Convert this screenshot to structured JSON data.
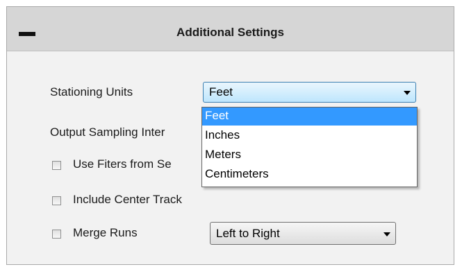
{
  "panel": {
    "title": "Additional Settings",
    "collapse_icon": "minus-icon"
  },
  "stationing": {
    "label": "Stationing Units",
    "selected": "Feet",
    "options": [
      "Feet",
      "Inches",
      "Meters",
      "Centimeters"
    ]
  },
  "output_sampling": {
    "label": "Output Sampling Inter"
  },
  "use_filters": {
    "label": "Use Fiters from Se",
    "checked": false
  },
  "center_track": {
    "label": "Include Center Track",
    "checked": false
  },
  "merge_runs": {
    "label": "Merge Runs",
    "checked": false,
    "selected": "Left to Right"
  },
  "colors": {
    "header_bg": "#d6d6d6",
    "panel_bg": "#f2f2f2",
    "highlight": "#3399ff"
  }
}
